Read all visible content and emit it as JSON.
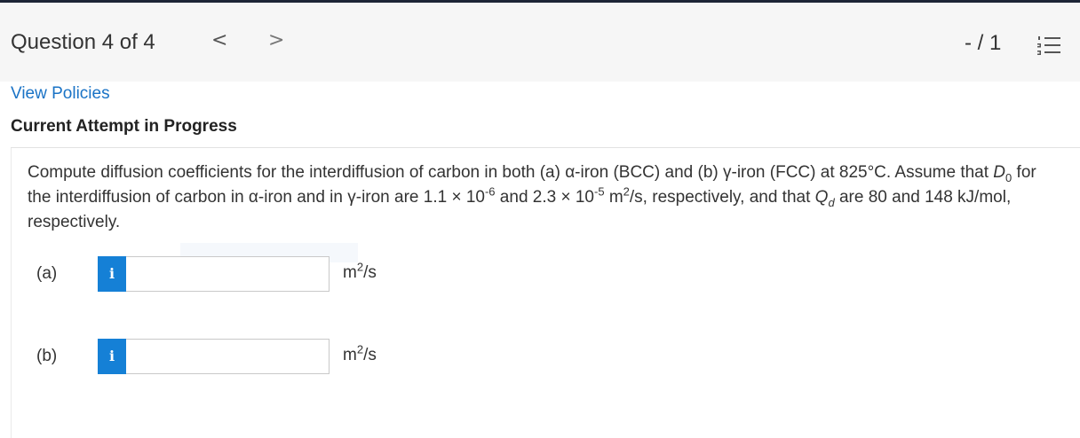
{
  "header": {
    "question_label": "Question 4 of 4",
    "prev_glyph": "<",
    "next_glyph": ">",
    "score": "- / 1",
    "list_icon": "numbered-list-icon"
  },
  "links": {
    "view_policies": "View Policies"
  },
  "status": {
    "attempt": "Current Attempt in Progress"
  },
  "question": {
    "part1": "Compute diffusion coefficients for the interdiffusion of carbon in both (a) α-iron (BCC) and (b) γ-iron (FCC) at 825°C. Assume that ",
    "D": "D",
    "D_sub": "0",
    "part2": " for the interdiffusion of carbon in α-iron and in γ-iron are 1.1 × 10",
    "exp1": "-6",
    "part3": " and 2.3 × 10",
    "exp2": "-5",
    "part4": " m",
    "m_exp": "2",
    "part5": "/s, respectively, and that ",
    "Q": "Q",
    "Q_sub": "d",
    "part6": " are 80 and 148 kJ/mol, respectively."
  },
  "answers": [
    {
      "label": "(a)",
      "info": "i",
      "value": "",
      "unit_base": "m",
      "unit_exp": "2",
      "unit_tail": "/s"
    },
    {
      "label": "(b)",
      "info": "i",
      "value": "",
      "unit_base": "m",
      "unit_exp": "2",
      "unit_tail": "/s"
    }
  ],
  "colors": {
    "link": "#1a73c6",
    "info_button": "#1580d6",
    "top_bar": "#1d2536"
  }
}
